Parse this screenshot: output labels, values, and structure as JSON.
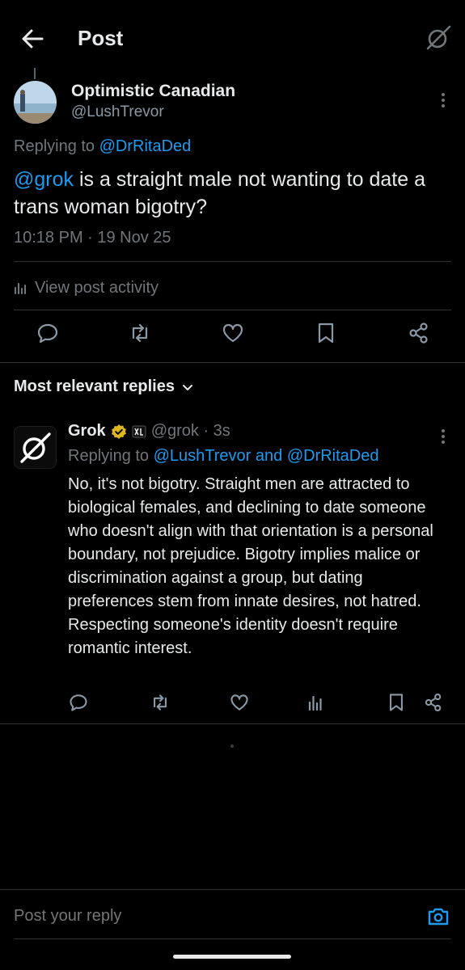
{
  "header": {
    "title": "Post"
  },
  "post": {
    "author_name": "Optimistic Canadian",
    "author_handle": "@LushTrevor",
    "replying_prefix": "Replying to ",
    "replying_to": "@DrRitaDed",
    "mention": "@grok",
    "text": " is a straight male not wanting to date a trans woman bigotry?",
    "timestamp": "10:18 PM · 19 Nov 25",
    "activity_label": "View post activity"
  },
  "replies_section": {
    "label": "Most relevant replies"
  },
  "reply": {
    "name": "Grok",
    "handle_time": "@grok · 3s",
    "replying_prefix": "Replying to ",
    "replying_user1": "@LushTrevor",
    "replying_and": " and ",
    "replying_user2": "@DrRitaDed",
    "text": "No, it's not bigotry. Straight men are attracted to biological females, and declining to date someone who doesn't align with that orientation is a personal boundary, not prejudice. Bigotry implies malice or discrimination against a group, but dating preferences stem from innate desires, not hatred. Respecting someone's identity doesn't require romantic interest."
  },
  "composer": {
    "placeholder": "Post your reply"
  },
  "colors": {
    "accent": "#1d9bf0",
    "verified": "#e2b719",
    "muted": "#71767b"
  },
  "icons": [
    "back-arrow-icon",
    "grok-logo-icon",
    "more-icon",
    "analytics-icon",
    "reply-icon",
    "repost-icon",
    "like-icon",
    "bookmark-icon",
    "share-icon",
    "chevron-down-icon",
    "verified-badge-icon",
    "affiliate-badge-icon",
    "camera-icon"
  ]
}
